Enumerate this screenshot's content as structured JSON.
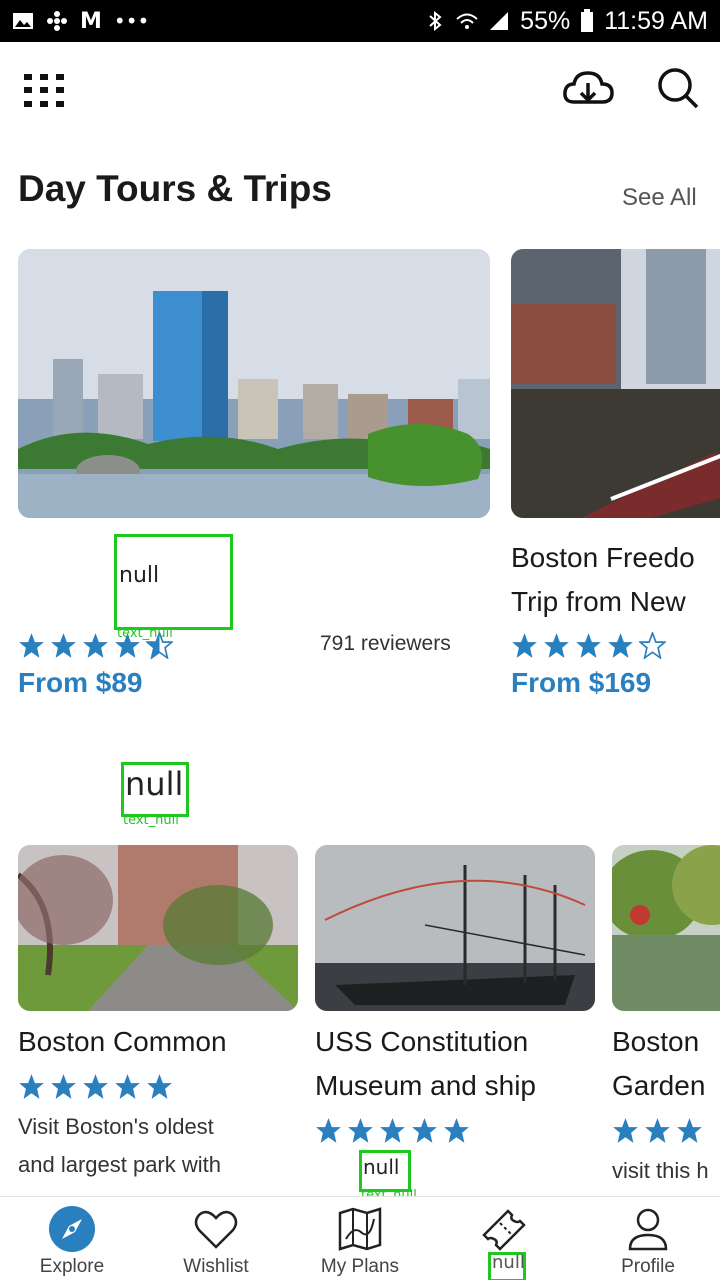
{
  "status_bar": {
    "battery": "55%",
    "time": "11:59 AM",
    "overflow": "•••"
  },
  "colors": {
    "accent": "#2a7fbf",
    "star": "#2a7fbf",
    "highlight_box": "#1ec81e"
  },
  "header": {
    "menu_icon": "grid-icon",
    "download_icon": "cloud-download-icon",
    "search_icon": "search-icon"
  },
  "section": {
    "title": "Day Tours & Trips",
    "see_all": "See All"
  },
  "tours": [
    {
      "title": "null",
      "caption": "text_null",
      "rating": 4.5,
      "reviewers": "791 reviewers",
      "price": "From $89"
    },
    {
      "title_line1": "Boston Freedo",
      "title_line2": "Trip from New",
      "rating": 4,
      "price": "From $169"
    }
  ],
  "attractions_heading": {
    "title": "null",
    "caption": "text_null"
  },
  "attractions": [
    {
      "title": "Boston Common",
      "rating": 5,
      "desc_line1": "Visit Boston's oldest",
      "desc_line2": "and largest park with"
    },
    {
      "title_line1": "USS Constitution",
      "title_line2": "Museum and ship",
      "rating": 5,
      "desc": "null",
      "caption": "text_null"
    },
    {
      "title_line1": "Boston",
      "title_line2": "Garden",
      "desc": "visit this h"
    }
  ],
  "bottom_nav": [
    {
      "label": "Explore",
      "icon": "compass-icon"
    },
    {
      "label": "Wishlist",
      "icon": "heart-icon"
    },
    {
      "label": "My Plans",
      "icon": "map-icon"
    },
    {
      "label": "null",
      "icon": "ticket-icon"
    },
    {
      "label": "Profile",
      "icon": "person-icon"
    }
  ]
}
